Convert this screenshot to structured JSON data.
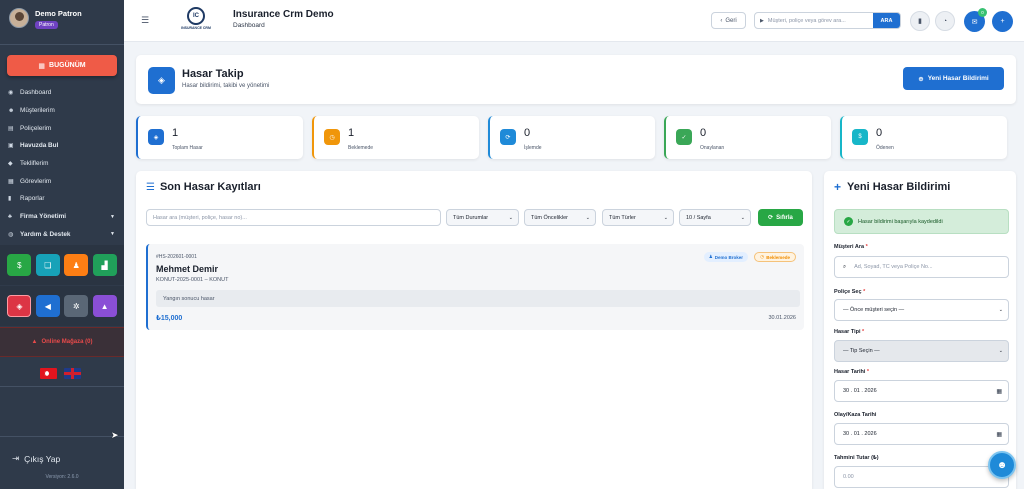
{
  "user": {
    "name": "Demo Patron",
    "role": "Patron"
  },
  "sidebar": {
    "today_label": "BUGÜNÜM",
    "items": [
      {
        "label": "Dashboard",
        "icon": "dashboard-icon"
      },
      {
        "label": "Müşterilerim",
        "icon": "users-icon"
      },
      {
        "label": "Poliçelerim",
        "icon": "file-icon"
      },
      {
        "label": "Havuzda Bul",
        "icon": "pool-icon"
      },
      {
        "label": "Tekliflerim",
        "icon": "tag-icon"
      },
      {
        "label": "Görevlerim",
        "icon": "calendar-icon"
      },
      {
        "label": "Raporlar",
        "icon": "chart-icon"
      },
      {
        "label": "Firma Yönetimi",
        "icon": "org-icon"
      },
      {
        "label": "Yardım & Destek",
        "icon": "help-icon"
      }
    ],
    "offline_label": "Online Mağaza (0)",
    "logout_label": "Çıkış Yap",
    "version": "Versiyon: 2.6.0"
  },
  "topbar": {
    "app_title": "Insurance Crm Demo",
    "page": "Dashboard",
    "logo_text": "INSURANCE CRM",
    "back_label": "Geri",
    "search_placeholder": "Müşteri, poliçe veya görev ara...",
    "search_button": "ARA",
    "mail_badge": "0"
  },
  "header": {
    "title": "Hasar Takip",
    "subtitle": "Hasar bildirimi, takibi ve yönetimi",
    "new_button": "Yeni Hasar Bildirimi"
  },
  "stats": [
    {
      "value": "1",
      "label": "Toplam Hasar",
      "color": "#1f6fd1"
    },
    {
      "value": "1",
      "label": "Beklemede",
      "color": "#f0960a"
    },
    {
      "value": "0",
      "label": "İşlemde",
      "color": "#1f8ad8"
    },
    {
      "value": "0",
      "label": "Onaylanan",
      "color": "#3aa757"
    },
    {
      "value": "0",
      "label": "Ödenen",
      "color": "#17b6c8"
    }
  ],
  "list": {
    "title": "Son Hasar Kayıtları",
    "search_placeholder": "Hasar ara (müşteri, poliçe, hasar no)...",
    "filters": [
      "Tüm Durumlar",
      "Tüm Öncelikler",
      "Tüm Türler",
      "10 / Sayfa"
    ],
    "reset_label": "Sıfırla",
    "record": {
      "number": "#HS-202601-0001",
      "name": "Mehmet Demir",
      "policy": "KONUT-2025-0001 – KONUT",
      "description": "Yangın sonucu hasar",
      "amount": "₺15,000",
      "date": "30.01.2026",
      "broker_tag": "Demo Broker",
      "status_tag": "Beklemede"
    }
  },
  "form": {
    "title": "Yeni Hasar Bildirimi",
    "success": "Hasar bildirimi başarıyla kaydedildi",
    "customer_label": "Müşteri Ara",
    "customer_placeholder": "Ad, Soyad, TC veya Poliçe No...",
    "policy_label": "Poliçe Seç",
    "policy_value": "— Önce müşteri seçin —",
    "type_label": "Hasar Tipi",
    "type_value": "— Tip Seçin —",
    "date_label": "Hasar Tarihi",
    "date_value": "30 . 01 . 2026",
    "event_label": "Olay/Kaza Tarihi",
    "event_value": "30 . 01 . 2026",
    "amount_label": "Tahmini Tutar (₺)",
    "amount_placeholder": "0.00",
    "required_mark": "*"
  }
}
